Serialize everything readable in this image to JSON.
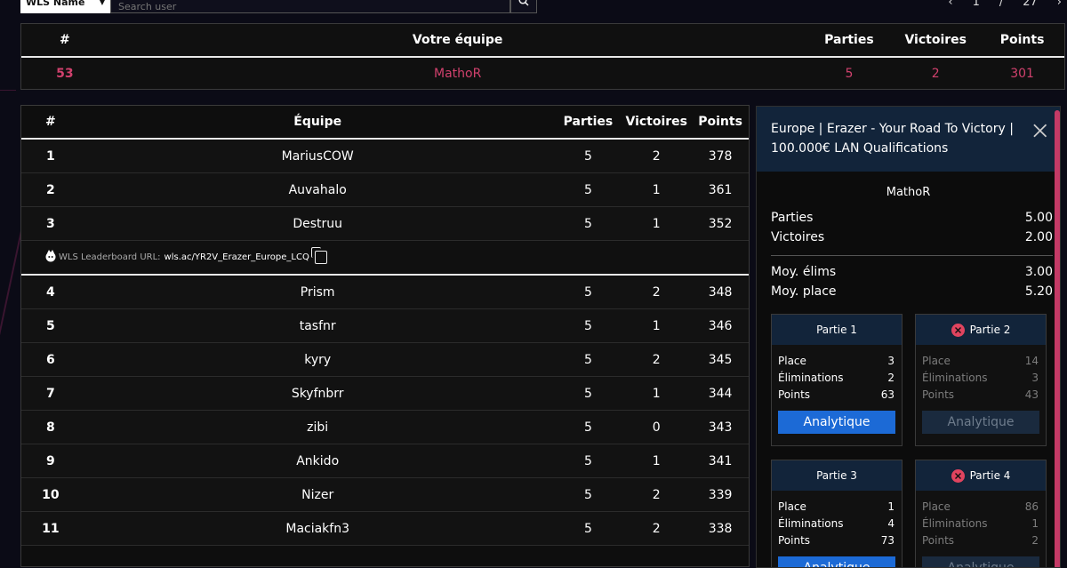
{
  "search": {
    "filter_label": "WLS Name",
    "placeholder": "Search user"
  },
  "pager": {
    "prev": "‹",
    "current": "1",
    "separator": "/",
    "total": "27",
    "next": "›"
  },
  "your_team": {
    "headers": {
      "num": "#",
      "team": "Votre équipe",
      "parties": "Parties",
      "victoires": "Victoires",
      "points": "Points"
    },
    "row": {
      "num": "53",
      "team": "MathoR",
      "parties": "5",
      "victoires": "2",
      "points": "301"
    }
  },
  "board": {
    "headers": {
      "num": "#",
      "team": "Équipe",
      "parties": "Parties",
      "victoires": "Victoires",
      "points": "Points"
    },
    "rows_top": [
      {
        "num": "1",
        "team": "MariusCOW",
        "parties": "5",
        "victoires": "2",
        "points": "378"
      },
      {
        "num": "2",
        "team": "Auvahalo",
        "parties": "5",
        "victoires": "1",
        "points": "361"
      },
      {
        "num": "3",
        "team": "Destruu",
        "parties": "5",
        "victoires": "1",
        "points": "352"
      }
    ],
    "url_row": {
      "label": "WLS Leaderboard URL:",
      "value": "wls.ac/YR2V_Erazer_Europe_LCQ"
    },
    "rows_bottom": [
      {
        "num": "4",
        "team": "Prism",
        "parties": "5",
        "victoires": "2",
        "points": "348"
      },
      {
        "num": "5",
        "team": "tasfnr",
        "parties": "5",
        "victoires": "1",
        "points": "346"
      },
      {
        "num": "6",
        "team": "kyry",
        "parties": "5",
        "victoires": "2",
        "points": "345"
      },
      {
        "num": "7",
        "team": "Skyfnbrr",
        "parties": "5",
        "victoires": "1",
        "points": "344"
      },
      {
        "num": "8",
        "team": "zibi",
        "parties": "5",
        "victoires": "0",
        "points": "343"
      },
      {
        "num": "9",
        "team": "Ankido",
        "parties": "5",
        "victoires": "1",
        "points": "341"
      },
      {
        "num": "10",
        "team": "Nizer",
        "parties": "5",
        "victoires": "2",
        "points": "339"
      },
      {
        "num": "11",
        "team": "Maciakfn3",
        "parties": "5",
        "victoires": "2",
        "points": "338"
      }
    ]
  },
  "panel": {
    "title": "Europe | Erazer - Your Road To Victory | 100.000€ LAN Qualifications",
    "team": "MathoR",
    "stats_a": [
      {
        "label": "Parties",
        "value": "5.00"
      },
      {
        "label": "Victoires",
        "value": "2.00"
      }
    ],
    "stats_b": [
      {
        "label": "Moy. élims",
        "value": "3.00"
      },
      {
        "label": "Moy. place",
        "value": "5.20"
      }
    ],
    "games": [
      {
        "title": "Partie 1",
        "failed": false,
        "place_label": "Place",
        "place": "3",
        "elims_label": "Éliminations",
        "elims": "2",
        "points_label": "Points",
        "points": "63",
        "button": "Analytique"
      },
      {
        "title": "Partie 2",
        "failed": true,
        "place_label": "Place",
        "place": "14",
        "elims_label": "Éliminations",
        "elims": "3",
        "points_label": "Points",
        "points": "43",
        "button": "Analytique"
      },
      {
        "title": "Partie 3",
        "failed": false,
        "place_label": "Place",
        "place": "1",
        "elims_label": "Éliminations",
        "elims": "4",
        "points_label": "Points",
        "points": "73",
        "button": "Analytique"
      },
      {
        "title": "Partie 4",
        "failed": true,
        "place_label": "Place",
        "place": "86",
        "elims_label": "Éliminations",
        "elims": "1",
        "points_label": "Points",
        "points": "2",
        "button": "Analytique"
      }
    ]
  },
  "colors": {
    "accent": "#d0416d",
    "panel_header": "#12243a",
    "button": "#1c6ad6"
  }
}
